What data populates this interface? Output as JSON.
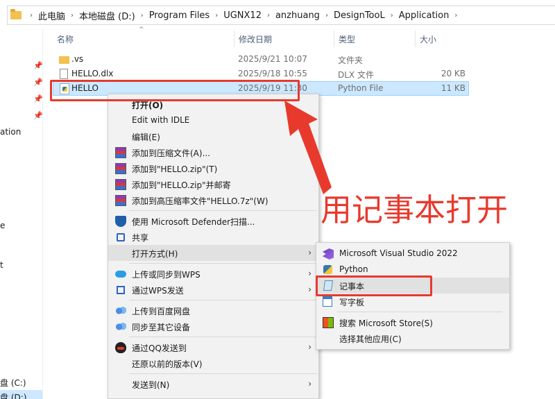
{
  "breadcrumbs": [
    "此电脑",
    "本地磁盘 (D:)",
    "Program Files",
    "UGNX12",
    "anzhuang",
    "DesignTooL",
    "Application"
  ],
  "nav": {
    "fragments": [
      "ation",
      "e",
      "t"
    ],
    "drives": [
      "盘 (C:)",
      "盘 (D:)"
    ]
  },
  "columns": {
    "name": "名称",
    "date": "修改日期",
    "type": "类型",
    "size": "大小"
  },
  "files": [
    {
      "name": ".vs",
      "date": "2025/9/21 10:07",
      "type": "文件夹",
      "size": "",
      "icon": "folder-icon"
    },
    {
      "name": "HELLO.dlx",
      "date": "2025/9/18 10:55",
      "type": "DLX 文件",
      "size": "20 KB",
      "icon": "file-icon"
    },
    {
      "name": "HELLO",
      "date": "2025/9/19 11:30",
      "type": "Python File",
      "size": "11 KB",
      "icon": "python-file-icon"
    }
  ],
  "context_menu": [
    {
      "label": "打开(O)",
      "bold": true
    },
    {
      "label": "Edit with IDLE"
    },
    {
      "label": "编辑(E)"
    },
    {
      "label": "添加到压缩文件(A)...",
      "icon": "winrar-icon"
    },
    {
      "label": "添加到\"HELLO.zip\"(T)",
      "icon": "winrar-icon"
    },
    {
      "label": "添加到\"HELLO.zip\"并邮寄",
      "icon": "winrar-icon"
    },
    {
      "label": "添加到高压缩率文件\"HELLO.7z\"(W)",
      "icon": "winrar-icon"
    },
    {
      "label": "使用 Microsoft Defender扫描...",
      "icon": "defender-shield-icon"
    },
    {
      "label": "共享",
      "icon": "share-icon"
    },
    {
      "label": "打开方式(H)",
      "submenu": true
    },
    {
      "label": "上传或同步到WPS",
      "icon": "wps-cloud-icon",
      "submenu": true
    },
    {
      "label": "通过WPS发送",
      "icon": "wps-send-icon",
      "submenu": true
    },
    {
      "label": "上传到百度网盘",
      "icon": "baidu-netdisk-icon"
    },
    {
      "label": "同步至其它设备",
      "icon": "baidu-sync-icon"
    },
    {
      "label": "通过QQ发送到",
      "icon": "qq-icon",
      "submenu": true
    },
    {
      "label": "还原以前的版本(V)"
    },
    {
      "label": "发送到(N)",
      "submenu": true
    }
  ],
  "open_with_submenu": [
    {
      "label": "Microsoft Visual Studio 2022",
      "icon": "visual-studio-icon"
    },
    {
      "label": "Python",
      "icon": "python-icon"
    },
    {
      "label": "记事本",
      "icon": "notepad-icon"
    },
    {
      "label": "写字板",
      "icon": "wordpad-icon"
    },
    {
      "label": "搜索 Microsoft Store(S)",
      "icon": "microsoft-store-icon"
    },
    {
      "label": "选择其他应用(C)"
    }
  ],
  "annotation": {
    "text": "用记事本打开",
    "color": "#e8392d"
  }
}
